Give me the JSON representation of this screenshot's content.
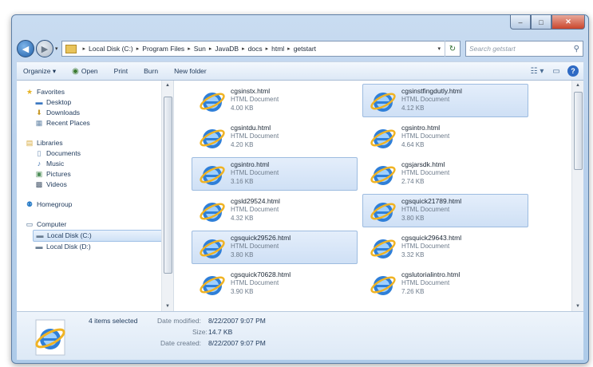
{
  "window": {
    "caption_buttons": [
      "–",
      "□",
      "✕"
    ]
  },
  "address": {
    "crumbs": [
      "Local Disk (C:)",
      "Program Files",
      "Sun",
      "JavaDB",
      "docs",
      "html",
      "getstart"
    ],
    "search_placeholder": "Search getstart"
  },
  "toolbar": {
    "organize": "Organize ▾",
    "open": "Open",
    "print": "Print",
    "burn": "Burn",
    "new_folder": "New folder"
  },
  "nav": {
    "favorites": "Favorites",
    "desktop": "Desktop",
    "downloads": "Downloads",
    "recent_places": "Recent Places",
    "libraries": "Libraries",
    "documents": "Documents",
    "music": "Music",
    "pictures": "Pictures",
    "videos": "Videos",
    "homegroup": "Homegroup",
    "computer": "Computer",
    "local_disk_c": "Local Disk (C:)",
    "local_disk_d": "Local Disk (D:)"
  },
  "files": [
    {
      "name": "cgsinstx.html",
      "type": "HTML Document",
      "size": "4.00 KB",
      "selected": false
    },
    {
      "name": "cgsinstfingdutly.html",
      "type": "HTML Document",
      "size": "4.12 KB",
      "selected": true
    },
    {
      "name": "cgsintdu.html",
      "type": "HTML Document",
      "size": "4.20 KB",
      "selected": false
    },
    {
      "name": "cgsintro.html",
      "type": "HTML Document",
      "size": "4.64 KB",
      "selected": false
    },
    {
      "name": "cgsintro.html",
      "type": "HTML Document",
      "size": "3.16 KB",
      "selected": true
    },
    {
      "name": "cgsjarsdk.html",
      "type": "HTML Document",
      "size": "2.74 KB",
      "selected": false
    },
    {
      "name": "cgsld29524.html",
      "type": "HTML Document",
      "size": "4.32 KB",
      "selected": false
    },
    {
      "name": "cgsquick21789.html",
      "type": "HTML Document",
      "size": "3.80 KB",
      "selected": true
    },
    {
      "name": "cgsquick29526.html",
      "type": "HTML Document",
      "size": "3.80 KB",
      "selected": true
    },
    {
      "name": "cgsquick29643.html",
      "type": "HTML Document",
      "size": "3.32 KB",
      "selected": false
    },
    {
      "name": "cgsquick70628.html",
      "type": "HTML Document",
      "size": "3.90 KB",
      "selected": false
    },
    {
      "name": "cgslutorialintro.html",
      "type": "HTML Document",
      "size": "7.26 KB",
      "selected": false
    }
  ],
  "details": {
    "selected_count": "4 items selected",
    "date_modified_label": "Date modified:",
    "date_modified": "8/22/2007 9:07 PM",
    "size_label": "Size:",
    "size": "14.7 KB",
    "date_created_label": "Date created:",
    "date_created": "8/22/2007 9:07 PM"
  },
  "colors": {
    "chrome": "#b9d1ec",
    "selection": "#cfe0f5",
    "text": "#1e395b"
  }
}
